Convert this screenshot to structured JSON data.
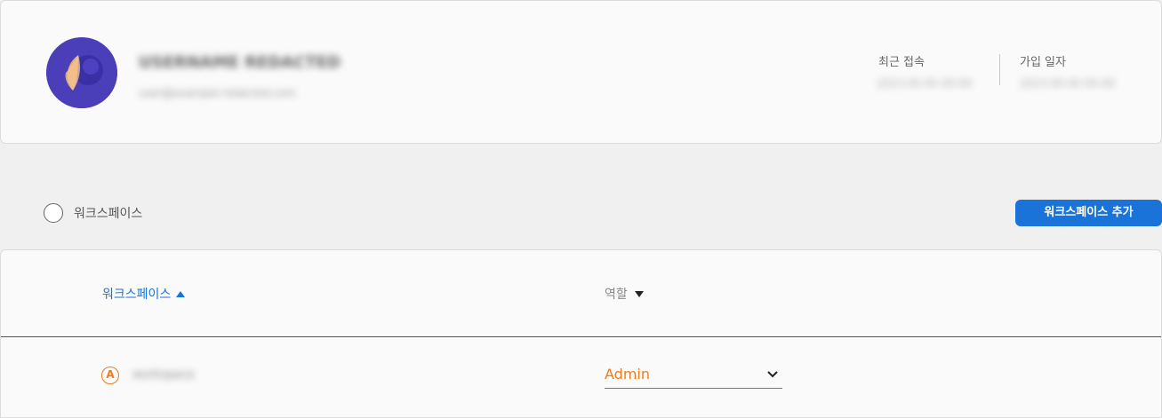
{
  "profile": {
    "name": "USERNAME REDACTED",
    "email": "user@example-redacted.com",
    "last_login_label": "최근 접속",
    "last_login_value": "2023.00.00 00:00",
    "joined_label": "가입 일자",
    "joined_value": "2023.00.00 00:00"
  },
  "filter": {
    "workspace_label": "워크스페이스",
    "add_button_label": "워크스페이스 추가"
  },
  "table": {
    "columns": {
      "workspace": "워크스페이스",
      "role": "역할"
    },
    "rows": [
      {
        "badge": "A",
        "workspace_name": "workspace",
        "role": "Admin"
      }
    ]
  },
  "colors": {
    "accent": "#1a73d9",
    "role_highlight": "#f07c1c",
    "avatar_bg": "#4a3fb8"
  },
  "icons": {
    "sort_asc": "caret-up-icon",
    "sort_desc": "caret-down-icon",
    "select": "chevron-down-icon"
  }
}
